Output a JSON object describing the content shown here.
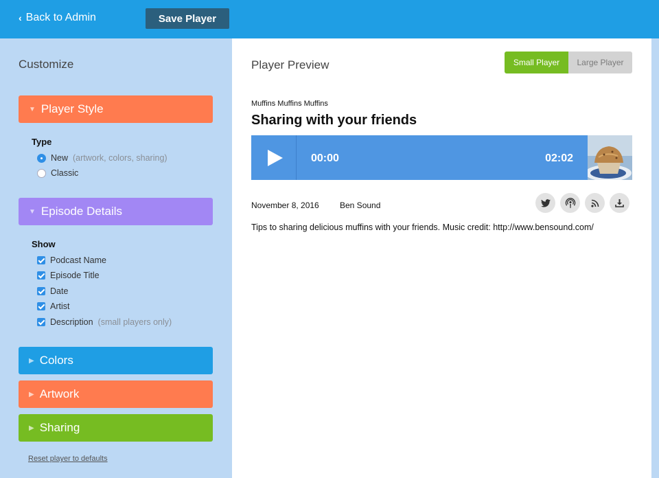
{
  "header": {
    "back_label": "Back to Admin",
    "save_label": "Save Player"
  },
  "sidebar": {
    "title": "Customize",
    "sections": {
      "player_style": {
        "label": "Player Style",
        "color": "#ff7b4f"
      },
      "episode_details": {
        "label": "Episode Details",
        "color": "#a287f4"
      },
      "colors": {
        "label": "Colors",
        "color": "#1f9ee4"
      },
      "artwork": {
        "label": "Artwork",
        "color": "#ff7b4f"
      },
      "sharing": {
        "label": "Sharing",
        "color": "#76bc22"
      }
    },
    "type_group": {
      "label": "Type",
      "options": [
        {
          "label": "New",
          "hint": "(artwork, colors, sharing)",
          "selected": true
        },
        {
          "label": "Classic",
          "hint": "",
          "selected": false
        }
      ]
    },
    "show_group": {
      "label": "Show",
      "options": [
        {
          "label": "Podcast Name",
          "hint": "",
          "checked": true
        },
        {
          "label": "Episode Title",
          "hint": "",
          "checked": true
        },
        {
          "label": "Date",
          "hint": "",
          "checked": true
        },
        {
          "label": "Artist",
          "hint": "",
          "checked": true
        },
        {
          "label": "Description",
          "hint": "(small players only)",
          "checked": true
        }
      ]
    },
    "reset_label": "Reset player to defaults"
  },
  "preview": {
    "title": "Player Preview",
    "size_options": {
      "small": "Small Player",
      "large": "Large Player",
      "selected": "small"
    },
    "podcast_name": "Muffins Muffins Muffins",
    "episode_title": "Sharing with your friends",
    "player": {
      "current_time": "00:00",
      "total_time": "02:02",
      "color": "#4f96e2"
    },
    "date": "November 8, 2016",
    "artist": "Ben Sound",
    "share_icons": [
      "twitter-icon",
      "podcast-icon",
      "rss-icon",
      "download-icon"
    ],
    "description": "Tips to sharing delicious muffins with your friends. Music credit: http://www.bensound.com/"
  }
}
